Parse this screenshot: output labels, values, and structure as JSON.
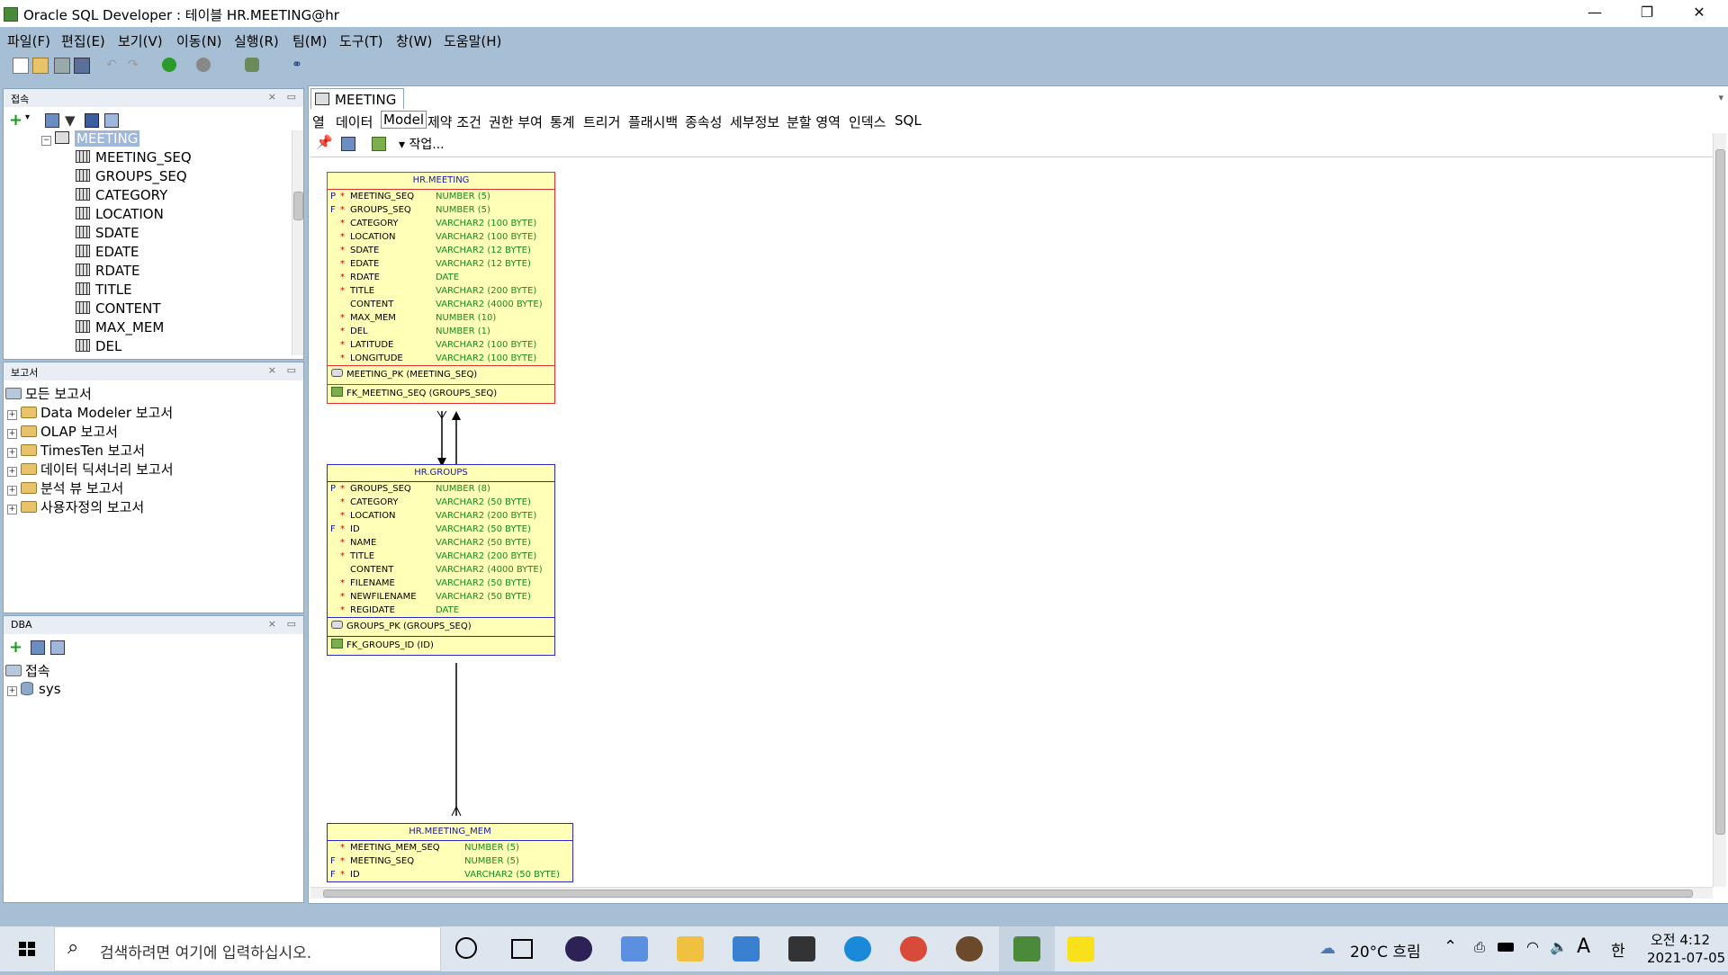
{
  "window": {
    "title": "Oracle SQL Developer : 테이블 HR.MEETING@hr",
    "minimize": "—",
    "restore": "❐",
    "close": "✕"
  },
  "menu": [
    "파일(F)",
    "편집(E)",
    "보기(V)",
    "이동(N)",
    "실행(R)",
    "팀(M)",
    "도구(T)",
    "창(W)",
    "도움말(H)"
  ],
  "connections_panel": {
    "title": "접속",
    "selected": "MEETING",
    "columns": [
      "MEETING_SEQ",
      "GROUPS_SEQ",
      "CATEGORY",
      "LOCATION",
      "SDATE",
      "EDATE",
      "RDATE",
      "TITLE",
      "CONTENT",
      "MAX_MEM",
      "DEL"
    ]
  },
  "reports_panel": {
    "title": "보고서",
    "root": "모든 보고서",
    "items": [
      "Data Modeler 보고서",
      "OLAP 보고서",
      "TimesTen 보고서",
      "데이터 딕셔너리 보고서",
      "분석 뷰 보고서",
      "사용자정의 보고서"
    ]
  },
  "dba_panel": {
    "title": "DBA",
    "root": "접속",
    "items": [
      "sys"
    ]
  },
  "editor": {
    "tab_label": "MEETING",
    "subtabs": [
      "열",
      "데이터",
      "Model",
      "제약 조건",
      "권한 부여",
      "통계",
      "트리거",
      "플래시백",
      "종속성",
      "세부정보",
      "분할 영역",
      "인덱스",
      "SQL"
    ],
    "active_subtab": "Model",
    "action_label": "▾ 작업..."
  },
  "entities": {
    "meeting": {
      "name": "HR.MEETING",
      "columns": [
        {
          "flag": "P",
          "req": "*",
          "name": "MEETING_SEQ",
          "type": "NUMBER (5)"
        },
        {
          "flag": "F",
          "req": "*",
          "name": "GROUPS_SEQ",
          "type": "NUMBER (5)"
        },
        {
          "flag": "",
          "req": "*",
          "name": "CATEGORY",
          "type": "VARCHAR2 (100 BYTE)"
        },
        {
          "flag": "",
          "req": "*",
          "name": "LOCATION",
          "type": "VARCHAR2 (100 BYTE)"
        },
        {
          "flag": "",
          "req": "*",
          "name": "SDATE",
          "type": "VARCHAR2 (12 BYTE)"
        },
        {
          "flag": "",
          "req": "*",
          "name": "EDATE",
          "type": "VARCHAR2 (12 BYTE)"
        },
        {
          "flag": "",
          "req": "*",
          "name": "RDATE",
          "type": "DATE"
        },
        {
          "flag": "",
          "req": "*",
          "name": "TITLE",
          "type": "VARCHAR2 (200 BYTE)"
        },
        {
          "flag": "",
          "req": "",
          "name": "CONTENT",
          "type": "VARCHAR2 (4000 BYTE)"
        },
        {
          "flag": "",
          "req": "*",
          "name": "MAX_MEM",
          "type": "NUMBER (10)"
        },
        {
          "flag": "",
          "req": "*",
          "name": "DEL",
          "type": "NUMBER (1)"
        },
        {
          "flag": "",
          "req": "*",
          "name": "LATITUDE",
          "type": "VARCHAR2 (100 BYTE)"
        },
        {
          "flag": "",
          "req": "*",
          "name": "LONGITUDE",
          "type": "VARCHAR2 (100 BYTE)"
        }
      ],
      "pk": "MEETING_PK (MEETING_SEQ)",
      "fk": "FK_MEETING_SEQ (GROUPS_SEQ)",
      "border_color": "#e03030"
    },
    "groups": {
      "name": "HR.GROUPS",
      "columns": [
        {
          "flag": "P",
          "req": "*",
          "name": "GROUPS_SEQ",
          "type": "NUMBER (8)"
        },
        {
          "flag": "",
          "req": "*",
          "name": "CATEGORY",
          "type": "VARCHAR2 (50 BYTE)"
        },
        {
          "flag": "",
          "req": "*",
          "name": "LOCATION",
          "type": "VARCHAR2 (200 BYTE)"
        },
        {
          "flag": "F",
          "req": "*",
          "name": "ID",
          "type": "VARCHAR2 (50 BYTE)"
        },
        {
          "flag": "",
          "req": "*",
          "name": "NAME",
          "type": "VARCHAR2 (50 BYTE)"
        },
        {
          "flag": "",
          "req": "*",
          "name": "TITLE",
          "type": "VARCHAR2 (200 BYTE)"
        },
        {
          "flag": "",
          "req": "",
          "name": "CONTENT",
          "type": "VARCHAR2 (4000 BYTE)"
        },
        {
          "flag": "",
          "req": "*",
          "name": "FILENAME",
          "type": "VARCHAR2 (50 BYTE)"
        },
        {
          "flag": "",
          "req": "*",
          "name": "NEWFILENAME",
          "type": "VARCHAR2 (50 BYTE)"
        },
        {
          "flag": "",
          "req": "*",
          "name": "REGIDATE",
          "type": "DATE"
        }
      ],
      "pk": "GROUPS_PK (GROUPS_SEQ)",
      "fk": "FK_GROUPS_ID (ID)",
      "border_color": "#2a2ac0"
    },
    "meeting_mem": {
      "name": "HR.MEETING_MEM",
      "columns": [
        {
          "flag": "",
          "req": "*",
          "name": "MEETING_MEM_SEQ",
          "type": "NUMBER (5)"
        },
        {
          "flag": "F",
          "req": "*",
          "name": "MEETING_SEQ",
          "type": "NUMBER (5)"
        },
        {
          "flag": "F",
          "req": "*",
          "name": "ID",
          "type": "VARCHAR2 (50 BYTE)"
        }
      ],
      "border_color": "#2a2ac0"
    }
  },
  "taskbar": {
    "search_placeholder": "검색하려면 여기에 입력하십시오.",
    "weather": "20°C 흐림",
    "ime": "한",
    "font_indicator": "A",
    "time": "오전 4:12",
    "date": "2021-07-05"
  },
  "colors": {
    "accent": "#a7bfd5",
    "entity_fill": "#ffffb8",
    "type_text": "#1a8a1a",
    "required": "#cc0000"
  },
  "icons": [
    "sql-developer-icon",
    "new-icon",
    "open-icon",
    "save-icon",
    "save-all-icon",
    "undo-icon",
    "redo-icon",
    "back-icon",
    "forward-icon",
    "db-icon",
    "binoculars-icon",
    "add-icon",
    "refresh-icon",
    "filter-icon",
    "windows-start-icon",
    "search-icon",
    "cortana-icon",
    "task-view-icon"
  ]
}
